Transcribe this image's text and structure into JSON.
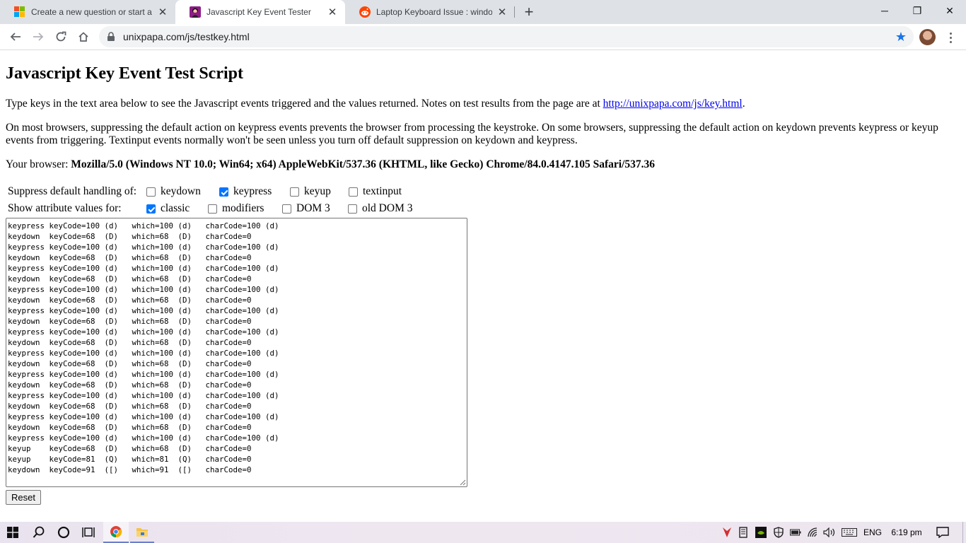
{
  "browser": {
    "tabs": [
      {
        "title": "Create a new question or start a d",
        "favicon": "microsoft-logo-icon",
        "active": false
      },
      {
        "title": "Javascript Key Event Tester",
        "favicon": "site-favicon-icon",
        "active": true
      },
      {
        "title": "Laptop Keyboard Issue : windows",
        "favicon": "reddit-icon",
        "active": false
      }
    ],
    "new_tab_label": "+",
    "window_controls": {
      "minimize": "─",
      "maximize": "❐",
      "close": "✕"
    },
    "url": "unixpapa.com/js/testkey.html"
  },
  "page": {
    "title": "Javascript Key Event Test Script",
    "intro_text": "Type keys in the text area below to see the Javascript events triggered and the values returned. Notes on test results from the page are at ",
    "intro_link": "http://unixpapa.com/js/key.html",
    "intro_end": ".",
    "notes": "On most browsers, suppressing the default action on keypress events prevents the browser from processing the keystroke. On some browsers, suppressing the default action on keydown prevents keypress or keyup events from triggering. Textinput events normally won't be seen unless you turn off default suppression on keydown and keypress.",
    "browser_label": "Your browser: ",
    "user_agent": "Mozilla/5.0 (Windows NT 10.0; Win64; x64) AppleWebKit/537.36 (KHTML, like Gecko) Chrome/84.0.4147.105 Safari/537.36",
    "suppress": {
      "label": "Suppress default handling of:",
      "options": [
        {
          "label": "keydown",
          "checked": false
        },
        {
          "label": "keypress",
          "checked": true
        },
        {
          "label": "keyup",
          "checked": false
        },
        {
          "label": "textinput",
          "checked": false
        }
      ]
    },
    "show_attrs": {
      "label": "Show attribute values for:",
      "options": [
        {
          "label": "classic",
          "checked": true
        },
        {
          "label": "modifiers",
          "checked": false
        },
        {
          "label": "DOM 3",
          "checked": false
        },
        {
          "label": "old DOM 3",
          "checked": false
        }
      ]
    },
    "event_log": [
      "keypress keyCode=100 (d)   which=100 (d)   charCode=100 (d)",
      "keydown  keyCode=68  (D)   which=68  (D)   charCode=0",
      "keypress keyCode=100 (d)   which=100 (d)   charCode=100 (d)",
      "keydown  keyCode=68  (D)   which=68  (D)   charCode=0",
      "keypress keyCode=100 (d)   which=100 (d)   charCode=100 (d)",
      "keydown  keyCode=68  (D)   which=68  (D)   charCode=0",
      "keypress keyCode=100 (d)   which=100 (d)   charCode=100 (d)",
      "keydown  keyCode=68  (D)   which=68  (D)   charCode=0",
      "keypress keyCode=100 (d)   which=100 (d)   charCode=100 (d)",
      "keydown  keyCode=68  (D)   which=68  (D)   charCode=0",
      "keypress keyCode=100 (d)   which=100 (d)   charCode=100 (d)",
      "keydown  keyCode=68  (D)   which=68  (D)   charCode=0",
      "keypress keyCode=100 (d)   which=100 (d)   charCode=100 (d)",
      "keydown  keyCode=68  (D)   which=68  (D)   charCode=0",
      "keypress keyCode=100 (d)   which=100 (d)   charCode=100 (d)",
      "keydown  keyCode=68  (D)   which=68  (D)   charCode=0",
      "keypress keyCode=100 (d)   which=100 (d)   charCode=100 (d)",
      "keydown  keyCode=68  (D)   which=68  (D)   charCode=0",
      "keypress keyCode=100 (d)   which=100 (d)   charCode=100 (d)",
      "keydown  keyCode=68  (D)   which=68  (D)   charCode=0",
      "keypress keyCode=100 (d)   which=100 (d)   charCode=100 (d)",
      "keyup    keyCode=68  (D)   which=68  (D)   charCode=0",
      "keyup    keyCode=81  (Q)   which=81  (Q)   charCode=0",
      "keydown  keyCode=91  ([)   which=91  ([)   charCode=0"
    ],
    "reset_label": "Reset"
  },
  "taskbar": {
    "language": "ENG",
    "time": "6:19 pm"
  }
}
